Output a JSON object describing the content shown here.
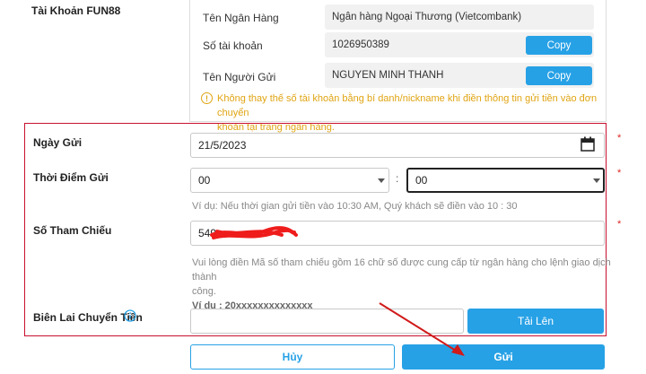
{
  "account_section": {
    "title": "Tài Khoản FUN88",
    "bank_label": "Tên Ngân Hàng",
    "bank_value": "Ngân hàng Ngoại Thương (Vietcombank)",
    "account_number_label": "Số tài khoản",
    "account_number_value": "1026950389",
    "sender_label": "Tên Người Gửi",
    "sender_value": "NGUYEN MINH THANH",
    "copy_label": "Copy",
    "warning_line1": "Không thay thế số tài khoản bằng bí danh/nickname khi điền thông tin gửi tiền vào đơn chuyển",
    "warning_line2": "khoản tại trang ngân hàng."
  },
  "form": {
    "date_label": "Ngày Gửi",
    "date_value": "21/5/2023",
    "time_label": "Thời Điểm Gửi",
    "hour_value": "00",
    "minute_value": "00",
    "time_separator": ":",
    "time_hint": "Ví dụ: Nếu thời gian gửi tiền vào 10:30 AM, Quý khách sẽ điền vào 10 : 30",
    "ref_label": "Số Tham Chiếu",
    "ref_value": "549",
    "ref_hint_line1": "Vui lòng điền Mã số tham chiếu gồm 16 chữ số được cung cấp từ ngân hàng cho lệnh giao dịch thành",
    "ref_hint_line2": "công.",
    "ref_example": "Ví dụ : 20xxxxxxxxxxxxxx",
    "receipt_label": "Biên Lai Chuyển Tiền",
    "upload_label": "Tải Lên",
    "required_mark": "*"
  },
  "actions": {
    "cancel_label": "Hủy",
    "submit_label": "Gửi"
  },
  "colors": {
    "accent": "#27a1e6",
    "warning": "#e0a412",
    "annotation_red": "#c8102e"
  }
}
